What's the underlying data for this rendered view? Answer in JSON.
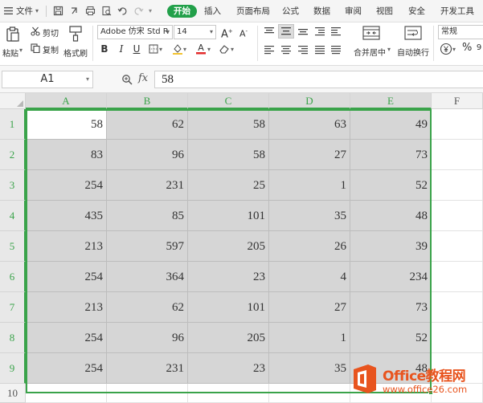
{
  "menubar": {
    "file_label": "文件",
    "tabs": [
      "开始",
      "插入",
      "页面布局",
      "公式",
      "数据",
      "审阅",
      "视图",
      "安全",
      "开发工具"
    ],
    "active_tab": "开始"
  },
  "ribbon": {
    "paste_label": "粘贴",
    "cut_label": "剪切",
    "copy_label": "复制",
    "format_painter_label": "格式刷",
    "font_name": "Adobe 仿宋 Std R",
    "font_size": "14",
    "merge_label": "合并居中",
    "wrap_label": "自动换行",
    "number_format": "常规",
    "icons": [
      "paste-icon",
      "scissors-icon",
      "copy-icon",
      "format-painter-icon",
      "bold-icon",
      "italic-icon",
      "underline-icon",
      "border-icon",
      "fill-color-icon",
      "font-color-icon",
      "clear-icon",
      "align-icon",
      "merge-icon",
      "wrap-icon",
      "currency-icon",
      "percent-icon"
    ]
  },
  "formula_bar": {
    "cell_ref": "A1",
    "fx_label": "fx",
    "value": "58"
  },
  "sheet": {
    "columns": [
      "A",
      "B",
      "C",
      "D",
      "E",
      "F"
    ],
    "rows": [
      "1",
      "2",
      "3",
      "4",
      "5",
      "6",
      "7",
      "8",
      "9",
      "10"
    ],
    "cells": [
      [
        "58",
        "62",
        "58",
        "63",
        "49"
      ],
      [
        "83",
        "96",
        "58",
        "27",
        "73"
      ],
      [
        "254",
        "231",
        "25",
        "1",
        "52"
      ],
      [
        "435",
        "85",
        "101",
        "35",
        "48"
      ],
      [
        "213",
        "597",
        "205",
        "26",
        "39"
      ],
      [
        "254",
        "364",
        "23",
        "4",
        "234"
      ],
      [
        "213",
        "62",
        "101",
        "27",
        "73"
      ],
      [
        "254",
        "96",
        "205",
        "1",
        "52"
      ],
      [
        "254",
        "231",
        "23",
        "35",
        "48"
      ]
    ],
    "selection": "A1:E9",
    "active_cell": "A1",
    "selection_color": "#3aa34a"
  },
  "watermark": {
    "title": "Office教程网",
    "url": "www.office26.com",
    "color": "#e8541e"
  }
}
